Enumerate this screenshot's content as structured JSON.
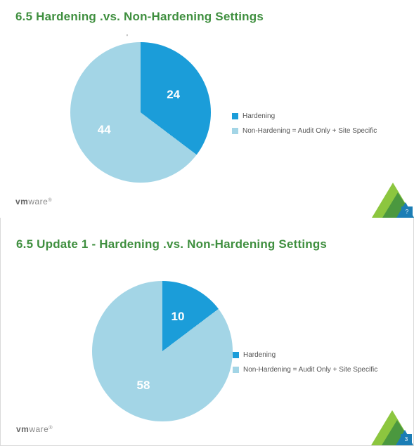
{
  "slides": [
    {
      "title": "6.5 Hardening .vs. Non-Hardening Settings",
      "legend": {
        "a": "Hardening",
        "b": "Non-Hardening = Audit Only + Site Specific"
      },
      "values": {
        "a": 24,
        "b": 44
      },
      "labels": {
        "a": "24",
        "b": "44"
      },
      "page": "?",
      "logo": "vmware"
    },
    {
      "title": "6.5 Update 1 -  Hardening .vs. Non-Hardening Settings",
      "legend": {
        "a": "Hardening",
        "b": "Non-Hardening = Audit Only + Site Specific"
      },
      "values": {
        "a": 10,
        "b": 58
      },
      "labels": {
        "a": "10",
        "b": "58"
      },
      "page": "3",
      "logo": "vmware"
    }
  ],
  "colors": {
    "hardening": "#1b9dd9",
    "nonhardening": "#a3d5e6",
    "deco_green_light": "#8cc63f",
    "deco_green_dark": "#3f8f3f",
    "deco_blue": "#1b7db5"
  },
  "chart_data": [
    {
      "type": "pie",
      "title": "6.5 Hardening .vs. Non-Hardening Settings",
      "series": [
        {
          "name": "Hardening",
          "value": 24,
          "color": "#1b9dd9"
        },
        {
          "name": "Non-Hardening = Audit Only + Site Specific",
          "value": 44,
          "color": "#a3d5e6"
        }
      ]
    },
    {
      "type": "pie",
      "title": "6.5 Update 1 -  Hardening .vs. Non-Hardening Settings",
      "series": [
        {
          "name": "Hardening",
          "value": 10,
          "color": "#1b9dd9"
        },
        {
          "name": "Non-Hardening = Audit Only + Site Specific",
          "value": 58,
          "color": "#a3d5e6"
        }
      ]
    }
  ]
}
